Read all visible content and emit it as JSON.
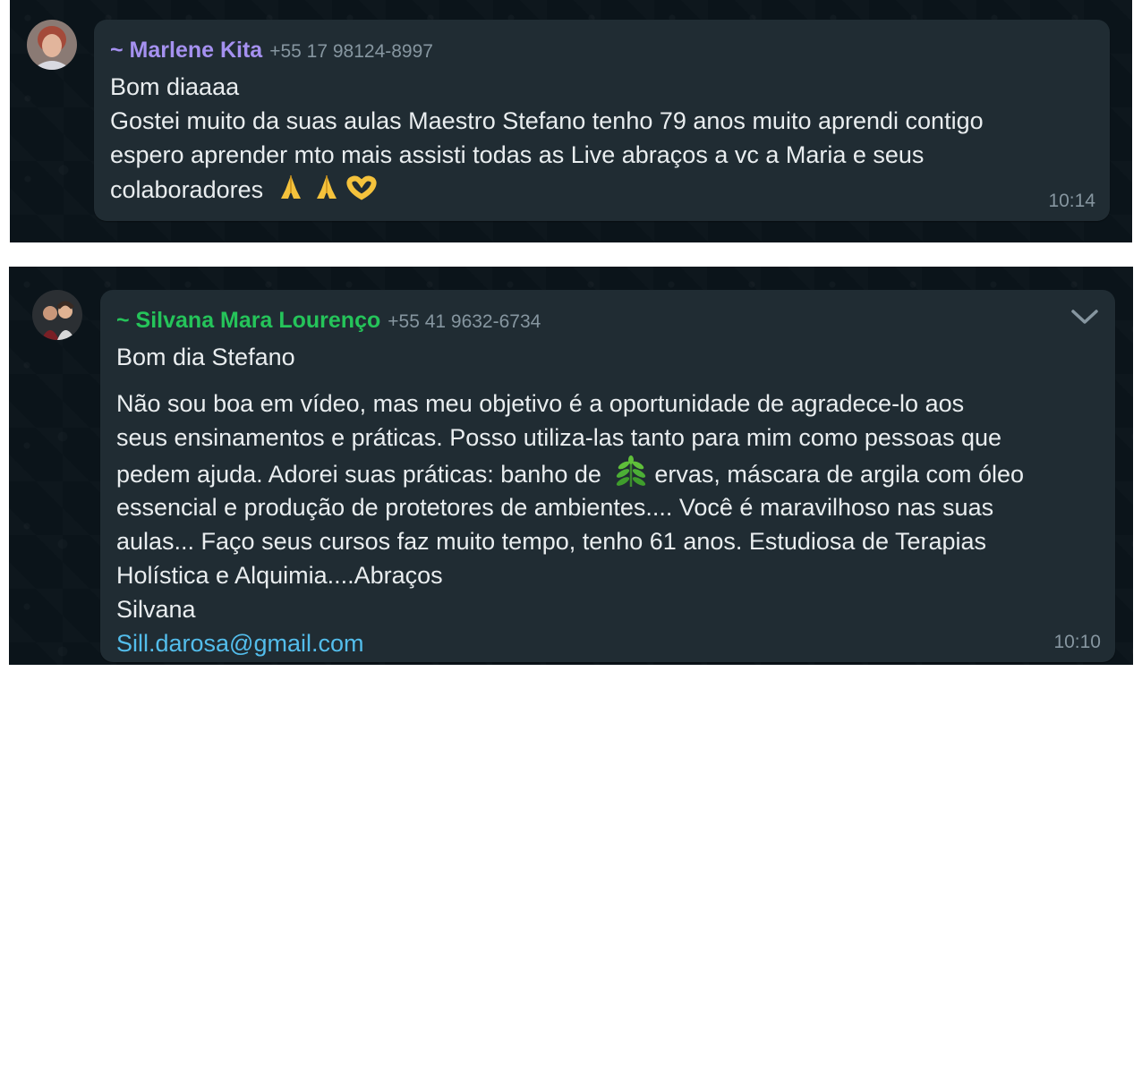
{
  "messages": [
    {
      "sender": "~ Marlene Kita",
      "phone": "+55 17 98124-8997",
      "name_color": "#a591f0",
      "lines": [
        "Bom diaaaa",
        "Gostei muito da suas aulas Maestro Stefano tenho 79 anos muito aprendi contigo",
        "espero aprender mto mais assisti todas as Live abraços a vc a Maria e seus",
        "colaboradores"
      ],
      "emojis": [
        "folded-hands",
        "folded-hands",
        "heart-hands"
      ],
      "time": "10:14"
    },
    {
      "sender": "~ Silvana Mara Lourenço",
      "phone": "+55 41 9632-6734",
      "name_color": "#25c45a",
      "lines": [
        "Bom dia Stefano",
        "Não sou boa em vídeo,  mas meu objetivo é a oportunidade de agradece-lo aos",
        "seus ensinamentos e práticas. Posso utiliza-las tanto para mim como pessoas que",
        "pedem ajuda. Adorei suas práticas: banho de",
        "ervas, máscara de argila com óleo",
        "essencial e produção de protetores de ambientes.... Você é maravilhoso nas suas",
        "aulas... Faço seus cursos faz muito tempo, tenho 61 anos. Estudiosa de Terapias",
        "Holística e Alquimia....Abraços",
        "Silvana"
      ],
      "link": "Sill.darosa@gmail.com",
      "inline_emoji": "herb",
      "time": "10:10",
      "menu_icon": "chevron-down-icon"
    }
  ]
}
